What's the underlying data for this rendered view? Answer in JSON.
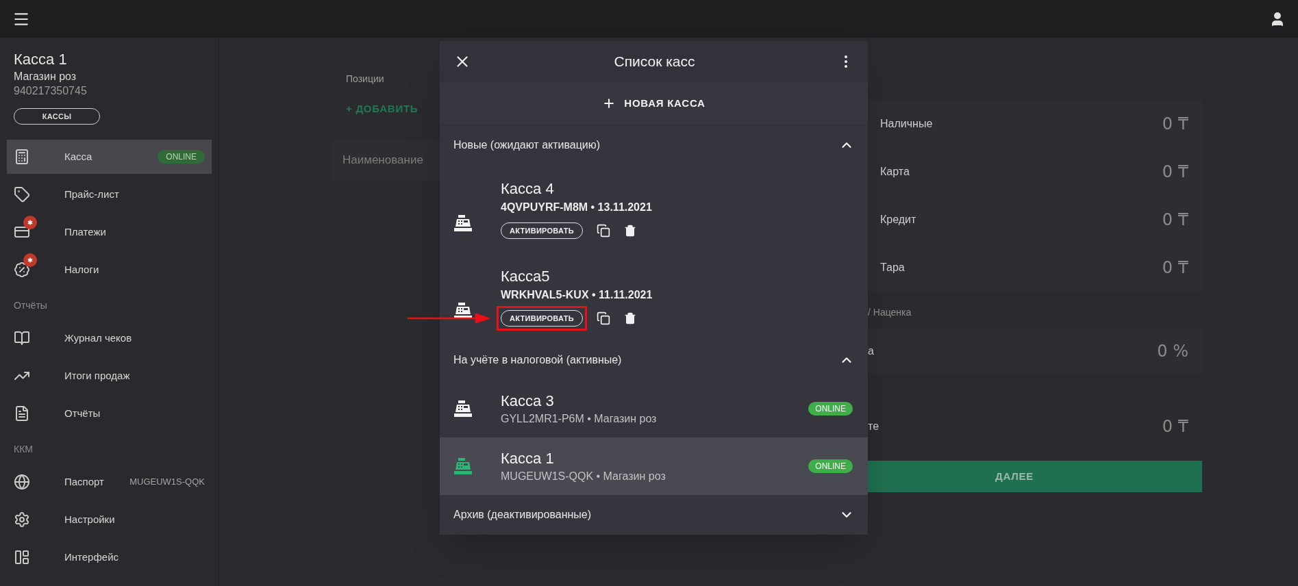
{
  "sidebar": {
    "title": "Касса 1",
    "store": "Магазин роз",
    "number": "940217350745",
    "cashes_button": "КАССЫ",
    "items": [
      {
        "kind": "item",
        "label": "Касса",
        "selected": true,
        "badge": "ONLINE",
        "alert": false
      },
      {
        "kind": "item",
        "label": "Прайс-лист",
        "selected": false,
        "alert": false
      },
      {
        "kind": "item",
        "label": "Платежи",
        "selected": false,
        "alert": true
      },
      {
        "kind": "item",
        "label": "Налоги",
        "selected": false,
        "alert": true
      },
      {
        "kind": "header",
        "label": "Отчёты"
      },
      {
        "kind": "item",
        "label": "Журнал чеков",
        "selected": false,
        "alert": false
      },
      {
        "kind": "item",
        "label": "Итоги продаж",
        "selected": false,
        "alert": false
      },
      {
        "kind": "item",
        "label": "Отчёты",
        "selected": false,
        "alert": false
      },
      {
        "kind": "header",
        "label": "ККМ"
      },
      {
        "kind": "item",
        "label": "Паспорт",
        "selected": false,
        "alert": false,
        "value": "MUGEUW1S-QQK"
      },
      {
        "kind": "item",
        "label": "Настройки",
        "selected": false,
        "alert": false
      },
      {
        "kind": "item",
        "label": "Интерфейс",
        "selected": false,
        "alert": false
      }
    ]
  },
  "background": {
    "positions_label": "Позиции",
    "add_button": "+ ДОБАВИТЬ",
    "name_column": "Наименование",
    "payments": [
      {
        "label": "Наличные",
        "amount": "0 ₸"
      },
      {
        "label": "Карта",
        "amount": "0 ₸"
      },
      {
        "label": "Кредит",
        "amount": "0 ₸"
      },
      {
        "label": "Тара",
        "amount": "0 ₸"
      }
    ],
    "discount_label": "/ Наценка",
    "discount_row": {
      "label": "а",
      "value": "0 %"
    },
    "total_row": {
      "label": "те",
      "value": "0 ₸"
    },
    "next_button": "ДАЛЕЕ"
  },
  "modal": {
    "title": "Список касс",
    "new_button": "НОВАЯ КАССА",
    "sections": [
      {
        "title": "Новые (ожидают активацию)",
        "expanded": true,
        "items": [
          {
            "kind": "pending",
            "name": "Касса 4",
            "detail": "4QVPUYRF-M8M • 13.11.2021",
            "action": "АКТИВИРОВАТЬ",
            "highlighted": false
          },
          {
            "kind": "pending",
            "name": "Касса5",
            "detail": "WRKHVAL5-KUX • 11.11.2021",
            "action": "АКТИВИРОВАТЬ",
            "highlighted": true
          }
        ]
      },
      {
        "title": "На учёте в налоговой (активные)",
        "expanded": true,
        "items": [
          {
            "kind": "active",
            "name": "Касса 3",
            "detail": "GYLL2MR1-P6M • Магазин роз",
            "status": "ONLINE",
            "selected": false
          },
          {
            "kind": "active",
            "name": "Касса 1",
            "detail": "MUGEUW1S-QQK • Магазин роз",
            "status": "ONLINE",
            "selected": true
          }
        ]
      },
      {
        "title": "Архив (деактивированные)",
        "expanded": false
      }
    ]
  }
}
